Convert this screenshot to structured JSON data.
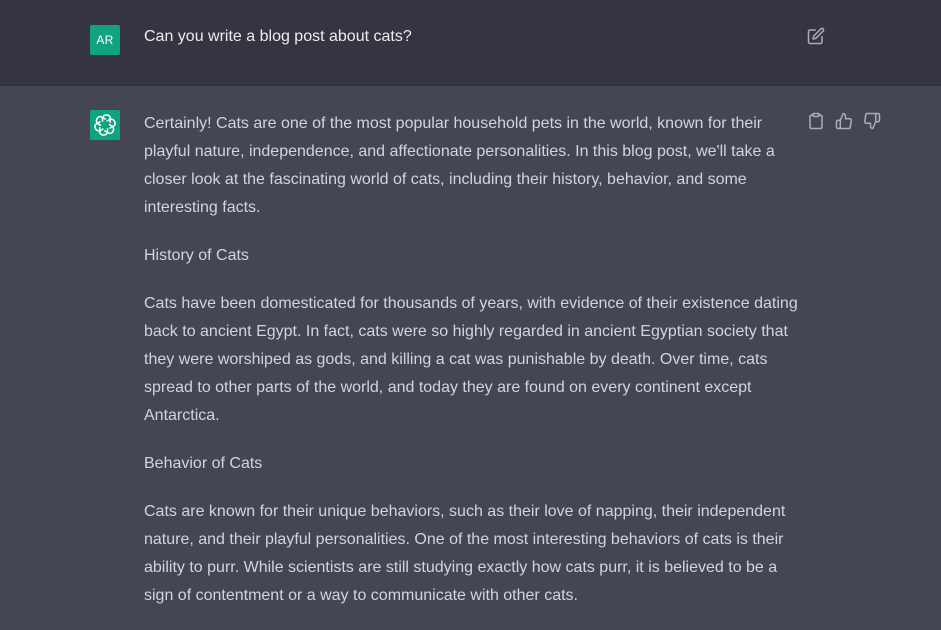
{
  "user_message": {
    "avatar_initials": "AR",
    "avatar_color": "#10a37f",
    "text": "Can you write a blog post about cats?",
    "edit_icon": "edit-icon"
  },
  "assistant_message": {
    "avatar_icon": "openai-logo-icon",
    "actions": [
      "clipboard-icon",
      "thumbs-up-icon",
      "thumbs-down-icon"
    ],
    "paragraphs": [
      "Certainly! Cats are one of the most popular household pets in the world, known for their playful nature, independence, and affectionate personalities. In this blog post, we'll take a closer look at the fascinating world of cats, including their history, behavior, and some interesting facts.",
      "History of Cats",
      "Cats have been domesticated for thousands of years, with evidence of their existence dating back to ancient Egypt. In fact, cats were so highly regarded in ancient Egyptian society that they were worshiped as gods, and killing a cat was punishable by death. Over time, cats spread to other parts of the world, and today they are found on every continent except Antarctica.",
      "Behavior of Cats",
      "Cats are known for their unique behaviors, such as their love of napping, their independent nature, and their playful personalities. One of the most interesting behaviors of cats is their ability to purr. While scientists are still studying exactly how cats purr, it is believed to be a sign of contentment or a way to communicate with other cats."
    ]
  },
  "colors": {
    "user_bg": "#343541",
    "assistant_bg": "#444654",
    "accent": "#10a37f",
    "text_primary": "#ececf1",
    "text_secondary": "#d1d5db",
    "icon": "#acacbe"
  }
}
